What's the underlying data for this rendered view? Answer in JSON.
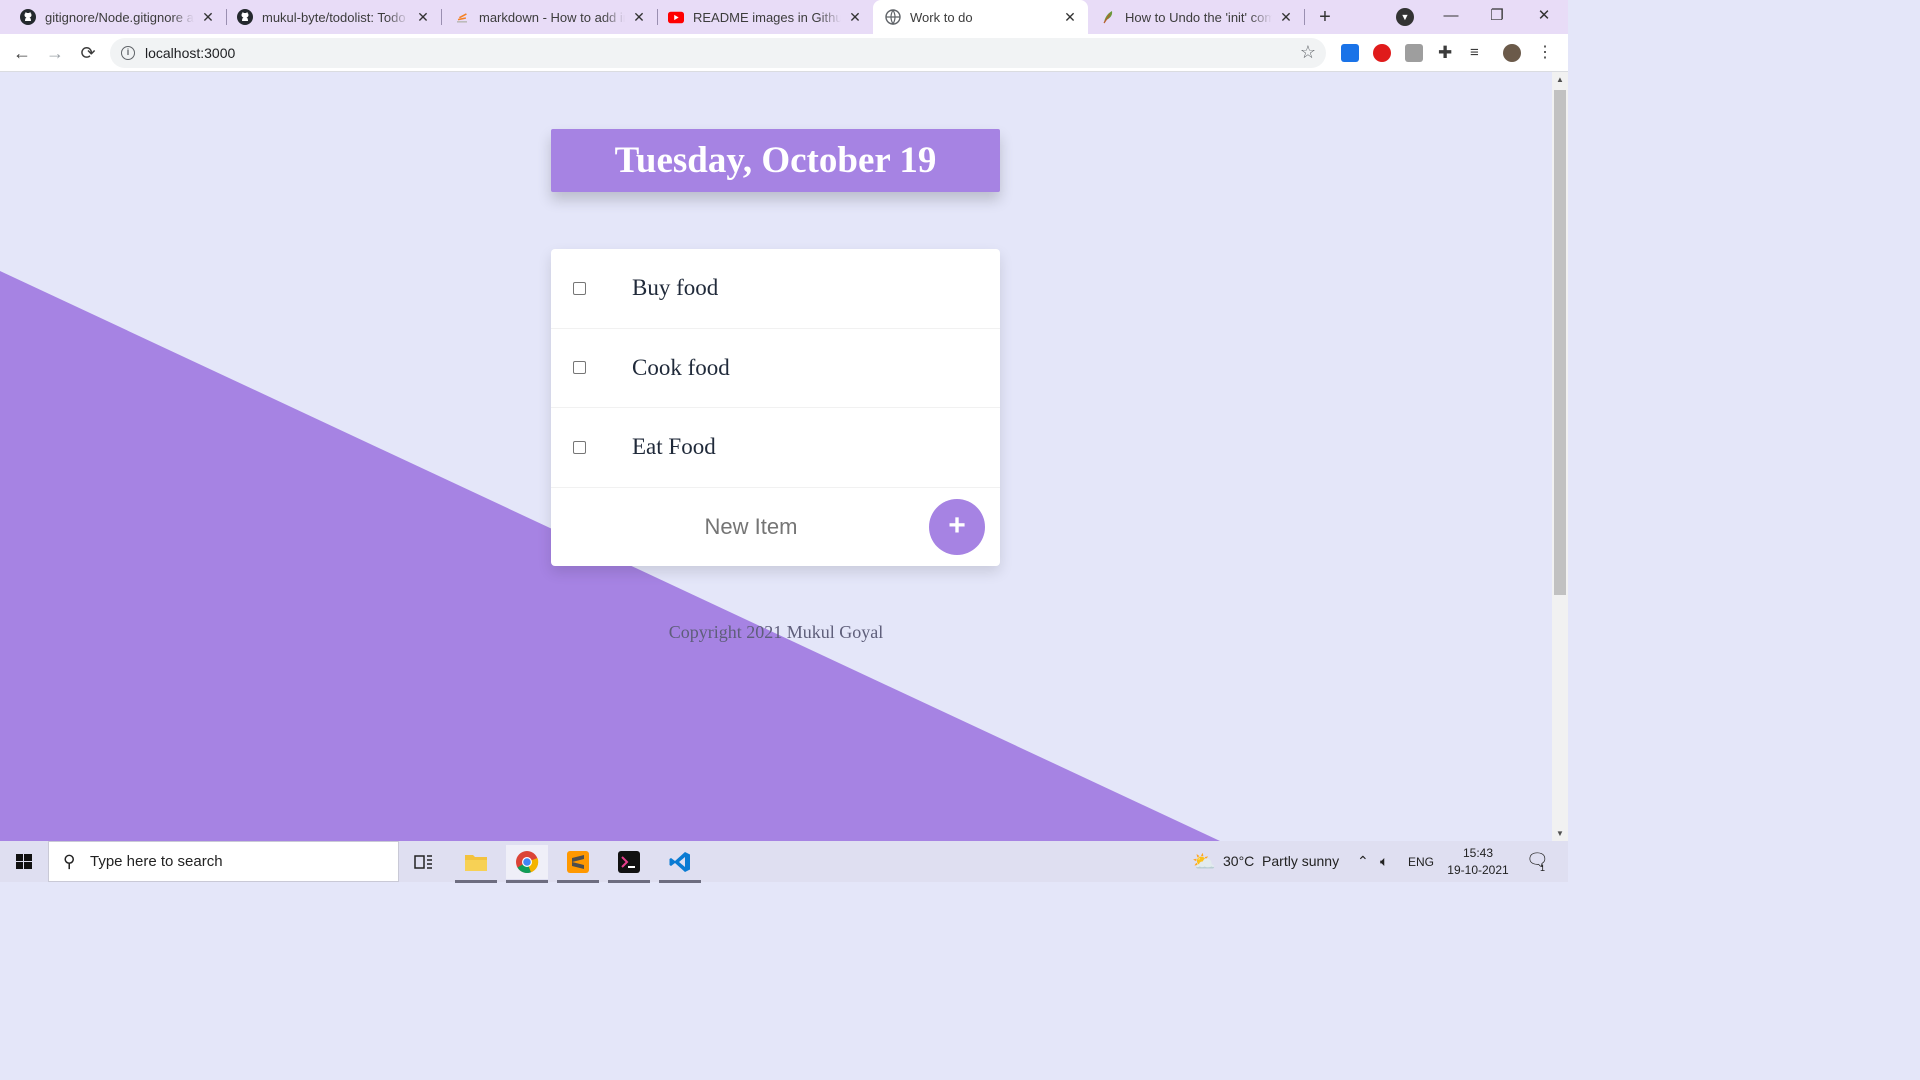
{
  "browser": {
    "tabs": [
      {
        "title": "gitignore/Node.gitignore at master · github/gitignore",
        "icon": "github-icon",
        "active": false
      },
      {
        "title": "mukul-byte/todolist: Todo List",
        "icon": "github-icon",
        "active": false
      },
      {
        "title": "markdown - How to add images to README",
        "icon": "stackoverflow-icon",
        "active": false
      },
      {
        "title": "README images in Github - YouTube",
        "icon": "youtube-icon",
        "active": false
      },
      {
        "title": "Work to do",
        "icon": "globe-icon",
        "active": true
      },
      {
        "title": "How to Undo the 'init' command",
        "icon": "feather-icon",
        "active": false
      }
    ],
    "url": "localhost:3000"
  },
  "page": {
    "heading": "Tuesday, October 19",
    "items": [
      {
        "label": "Buy food",
        "checked": false
      },
      {
        "label": "Cook food",
        "checked": false
      },
      {
        "label": "Eat Food",
        "checked": false
      }
    ],
    "new_item_placeholder": "New Item",
    "add_label": "+",
    "footer": "Copyright 2021 Mukul Goyal"
  },
  "taskbar": {
    "search_placeholder": "Type here to search",
    "weather": "30°C  Partly sunny",
    "language": "ENG",
    "time": "15:43",
    "date": "19-10-2021",
    "notification_count": "1"
  },
  "colors": {
    "accent": "#a683e3",
    "page_background": "#e4e6f9",
    "card": "#ffffff"
  }
}
